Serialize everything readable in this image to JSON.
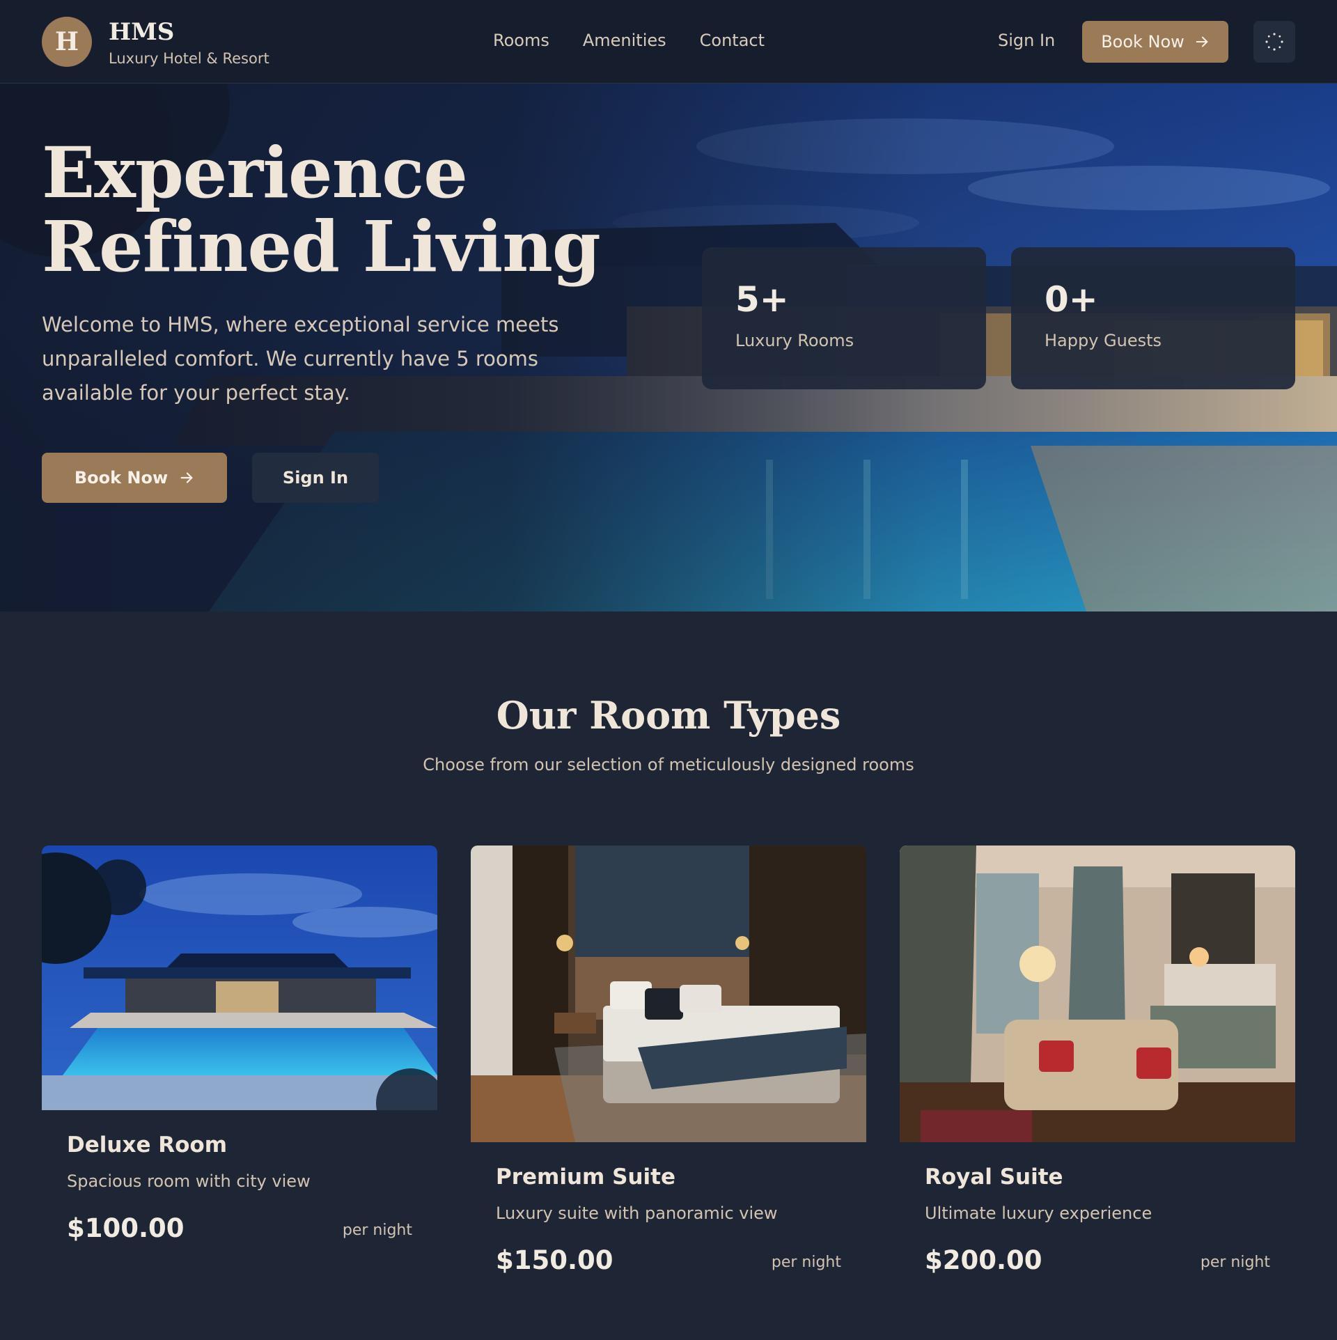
{
  "header": {
    "logo_letter": "H",
    "brand_name": "HMS",
    "brand_tagline": "Luxury Hotel & Resort",
    "nav": [
      {
        "label": "Rooms"
      },
      {
        "label": "Amenities"
      },
      {
        "label": "Contact"
      }
    ],
    "sign_in_label": "Sign In",
    "book_now_label": "Book Now",
    "book_now_icon": "arrow-right-icon",
    "theme_toggle_icon": "loader-icon"
  },
  "hero": {
    "title_line1": "Experience",
    "title_line2": "Refined Living",
    "description": "Welcome to HMS, where exceptional service meets unparalleled comfort. We currently have 5 rooms available for your perfect stay.",
    "book_now_label": "Book Now",
    "sign_in_label": "Sign In",
    "stats": [
      {
        "value": "5+",
        "label": "Luxury Rooms"
      },
      {
        "value": "0+",
        "label": "Happy Guests"
      }
    ]
  },
  "rooms_section": {
    "title": "Our Room Types",
    "subtitle": "Choose from our selection of meticulously designed rooms",
    "rooms": [
      {
        "name": "Deluxe Room",
        "description": "Spacious room with city view",
        "price": "$100.00",
        "unit": "per night"
      },
      {
        "name": "Premium Suite",
        "description": "Luxury suite with panoramic view",
        "price": "$150.00",
        "unit": "per night"
      },
      {
        "name": "Royal Suite",
        "description": "Ultimate luxury experience",
        "price": "$200.00",
        "unit": "per night"
      }
    ]
  },
  "colors": {
    "background": "#1e2636",
    "header_bg": "#161e2e",
    "accent": "#9b7a57",
    "text_primary": "#efe5d9",
    "text_secondary": "#d3c3b1"
  }
}
